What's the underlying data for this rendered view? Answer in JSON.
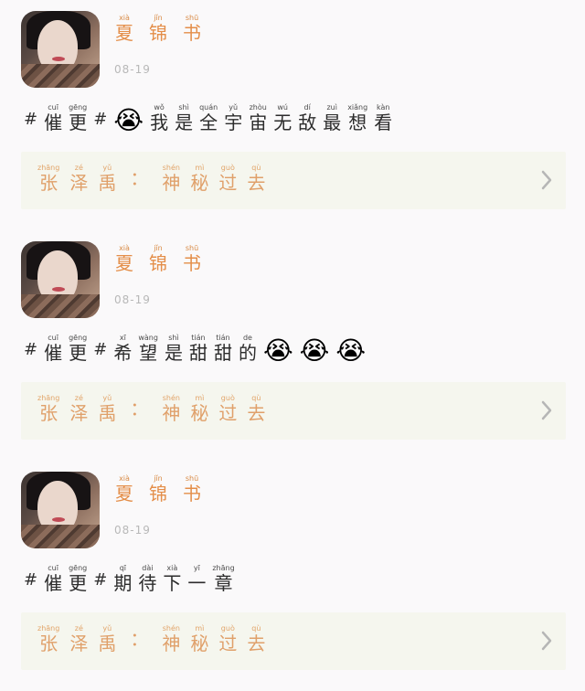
{
  "posts": [
    {
      "author": [
        {
          "py": "xià",
          "cn": "夏"
        },
        {
          "py": "jǐn",
          "cn": "锦"
        },
        {
          "py": "shū",
          "cn": "书"
        }
      ],
      "date": "08-19",
      "tag_word": [
        {
          "py": "cuī",
          "cn": "催"
        },
        {
          "py": "gēng",
          "cn": "更"
        }
      ],
      "text": [
        {
          "py": "wǒ",
          "cn": "我"
        },
        {
          "py": "shì",
          "cn": "是"
        },
        {
          "py": "quán",
          "cn": "全"
        },
        {
          "py": "yǔ",
          "cn": "宇"
        },
        {
          "py": "zhòu",
          "cn": "宙"
        },
        {
          "py": "wú",
          "cn": "无"
        },
        {
          "py": "dí",
          "cn": "敌"
        },
        {
          "py": "zuì",
          "cn": "最"
        },
        {
          "py": "xiǎng",
          "cn": "想"
        },
        {
          "py": "kàn",
          "cn": "看"
        }
      ],
      "emojis_before_text": [
        "😭"
      ],
      "emojis_after_text": [],
      "link": {
        "left": [
          {
            "py": "zhāng",
            "cn": "张"
          },
          {
            "py": "zé",
            "cn": "泽"
          },
          {
            "py": "yǔ",
            "cn": "禹"
          }
        ],
        "separator": "：",
        "right": [
          {
            "py": "shén",
            "cn": "神"
          },
          {
            "py": "mì",
            "cn": "秘"
          },
          {
            "py": "guò",
            "cn": "过"
          },
          {
            "py": "qù",
            "cn": "去"
          }
        ]
      }
    },
    {
      "author": [
        {
          "py": "xià",
          "cn": "夏"
        },
        {
          "py": "jǐn",
          "cn": "锦"
        },
        {
          "py": "shū",
          "cn": "书"
        }
      ],
      "date": "08-19",
      "tag_word": [
        {
          "py": "cuī",
          "cn": "催"
        },
        {
          "py": "gēng",
          "cn": "更"
        }
      ],
      "text": [
        {
          "py": "xī",
          "cn": "希"
        },
        {
          "py": "wàng",
          "cn": "望"
        },
        {
          "py": "shì",
          "cn": "是"
        },
        {
          "py": "tián",
          "cn": "甜"
        },
        {
          "py": "tián",
          "cn": "甜"
        },
        {
          "py": "de",
          "cn": "的"
        }
      ],
      "emojis_before_text": [],
      "emojis_after_text": [
        "😭",
        "😭",
        "😭"
      ],
      "link": {
        "left": [
          {
            "py": "zhāng",
            "cn": "张"
          },
          {
            "py": "zé",
            "cn": "泽"
          },
          {
            "py": "yǔ",
            "cn": "禹"
          }
        ],
        "separator": "：",
        "right": [
          {
            "py": "shén",
            "cn": "神"
          },
          {
            "py": "mì",
            "cn": "秘"
          },
          {
            "py": "guò",
            "cn": "过"
          },
          {
            "py": "qù",
            "cn": "去"
          }
        ]
      }
    },
    {
      "author": [
        {
          "py": "xià",
          "cn": "夏"
        },
        {
          "py": "jǐn",
          "cn": "锦"
        },
        {
          "py": "shū",
          "cn": "书"
        }
      ],
      "date": "08-19",
      "tag_word": [
        {
          "py": "cuī",
          "cn": "催"
        },
        {
          "py": "gēng",
          "cn": "更"
        }
      ],
      "text": [
        {
          "py": "qī",
          "cn": "期"
        },
        {
          "py": "dài",
          "cn": "待"
        },
        {
          "py": "xià",
          "cn": "下"
        },
        {
          "py": "yī",
          "cn": "一"
        },
        {
          "py": "zhāng",
          "cn": "章"
        }
      ],
      "emojis_before_text": [],
      "emojis_after_text": [],
      "link": {
        "left": [
          {
            "py": "zhāng",
            "cn": "张"
          },
          {
            "py": "zé",
            "cn": "泽"
          },
          {
            "py": "yǔ",
            "cn": "禹"
          }
        ],
        "separator": "：",
        "right": [
          {
            "py": "shén",
            "cn": "神"
          },
          {
            "py": "mì",
            "cn": "秘"
          },
          {
            "py": "guò",
            "cn": "过"
          },
          {
            "py": "qù",
            "cn": "去"
          }
        ]
      }
    }
  ],
  "hash_symbol": "#",
  "icons": {
    "avatar": "profile-photo",
    "chevron": "chevron-right-icon",
    "emoji": "loudly-crying-face-emoji"
  },
  "colors": {
    "author": "#e48e49",
    "date": "#b8b8b8",
    "card_bg": "#f5f6ee",
    "link_text": "#e0a06a",
    "body_text": "#2c2c2c",
    "chevron": "#b6b6b6"
  }
}
